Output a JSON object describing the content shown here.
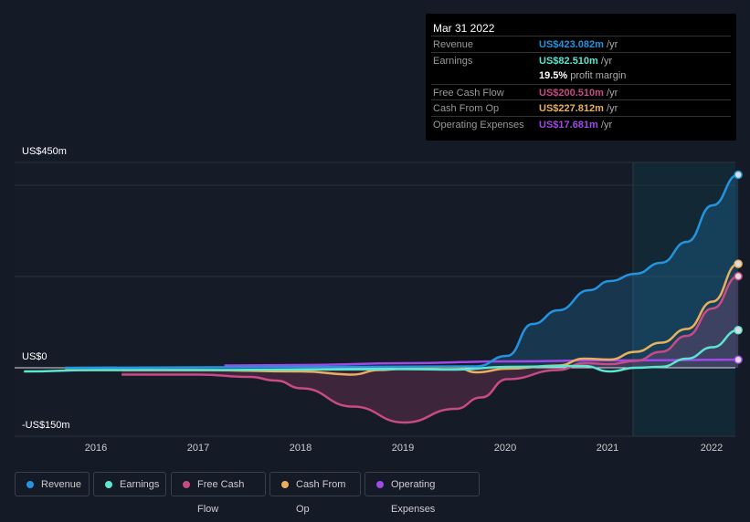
{
  "tooltip": {
    "date": "Mar 31 2022",
    "rows": [
      {
        "label": "Revenue",
        "value": "US$423.082m",
        "unit": " /yr",
        "color": "#2394df"
      },
      {
        "label": "Earnings",
        "value": "US$82.510m",
        "unit": " /yr",
        "color": "#5ce5cf"
      },
      {
        "label": "",
        "value": "19.5%",
        "unit": " profit margin",
        "color": "#ffffff"
      },
      {
        "label": "Free Cash Flow",
        "value": "US$200.510m",
        "unit": " /yr",
        "color": "#c84a86"
      },
      {
        "label": "Cash From Op",
        "value": "US$227.812m",
        "unit": " /yr",
        "color": "#e8b05d"
      },
      {
        "label": "Operating Expenses",
        "value": "US$17.681m",
        "unit": " /yr",
        "color": "#9f4ae8"
      }
    ]
  },
  "chart_data": {
    "type": "line",
    "ylim": [
      -150,
      450
    ],
    "y_tick_labels": [
      "US$450m",
      "US$0",
      "-US$150m"
    ],
    "x_tick_labels": [
      "2016",
      "2017",
      "2018",
      "2019",
      "2020",
      "2021",
      "2022"
    ],
    "series": [
      {
        "name": "Revenue",
        "color": "#2394df",
        "area": true,
        "points": [
          [
            2015.7,
            0
          ],
          [
            2019.7,
            3
          ],
          [
            2020,
            26
          ],
          [
            2020.25,
            96
          ],
          [
            2020.5,
            126
          ],
          [
            2020.8,
            170
          ],
          [
            2021,
            190
          ],
          [
            2021.25,
            206
          ],
          [
            2021.5,
            230
          ],
          [
            2021.75,
            276
          ],
          [
            2022,
            356
          ],
          [
            2022.25,
            423.082
          ]
        ]
      },
      {
        "name": "Earnings",
        "color": "#5ce5cf",
        "area": false,
        "points": [
          [
            2015.3,
            -8
          ],
          [
            2016,
            -5
          ],
          [
            2017,
            -5
          ],
          [
            2018,
            -4
          ],
          [
            2019,
            -3
          ],
          [
            2019.5,
            -4
          ],
          [
            2020,
            2
          ],
          [
            2020.75,
            4
          ],
          [
            2021,
            -8
          ],
          [
            2021.25,
            0
          ],
          [
            2021.5,
            2
          ],
          [
            2021.75,
            20
          ],
          [
            2022,
            45
          ],
          [
            2022.25,
            82.51
          ]
        ]
      },
      {
        "name": "Free Cash Flow",
        "color": "#c84a86",
        "area": true,
        "points": [
          [
            2016.25,
            -15
          ],
          [
            2017,
            -15
          ],
          [
            2017.5,
            -20
          ],
          [
            2017.75,
            -28
          ],
          [
            2018,
            -45
          ],
          [
            2018.5,
            -85
          ],
          [
            2019,
            -120
          ],
          [
            2019.5,
            -90
          ],
          [
            2019.75,
            -65
          ],
          [
            2020,
            -25
          ],
          [
            2020.5,
            -5
          ],
          [
            2020.75,
            10
          ],
          [
            2021,
            8
          ],
          [
            2021.25,
            15
          ],
          [
            2021.5,
            35
          ],
          [
            2021.75,
            70
          ],
          [
            2022,
            130
          ],
          [
            2022.25,
            200.51
          ]
        ]
      },
      {
        "name": "Cash From Op",
        "color": "#e8b05d",
        "area": false,
        "points": [
          [
            2015.7,
            -5
          ],
          [
            2017,
            -5
          ],
          [
            2018,
            -8
          ],
          [
            2018.5,
            -15
          ],
          [
            2018.75,
            -5
          ],
          [
            2019,
            -2
          ],
          [
            2019.5,
            2
          ],
          [
            2019.7,
            -10
          ],
          [
            2020,
            -2
          ],
          [
            2020.5,
            5
          ],
          [
            2020.75,
            20
          ],
          [
            2021,
            18
          ],
          [
            2021.25,
            35
          ],
          [
            2021.5,
            55
          ],
          [
            2021.75,
            85
          ],
          [
            2022,
            145
          ],
          [
            2022.25,
            227.812
          ]
        ]
      },
      {
        "name": "Operating Expenses",
        "color": "#9f4ae8",
        "area": false,
        "points": [
          [
            2017.25,
            5
          ],
          [
            2018,
            6
          ],
          [
            2019,
            10
          ],
          [
            2020,
            14
          ],
          [
            2021,
            16
          ],
          [
            2022.25,
            17.681
          ]
        ]
      }
    ]
  },
  "legend": [
    {
      "label": "Revenue",
      "color": "#2394df"
    },
    {
      "label": "Earnings",
      "color": "#5ce5cf"
    },
    {
      "label": "Free Cash Flow",
      "color": "#c84a86"
    },
    {
      "label": "Cash From Op",
      "color": "#e8b05d"
    },
    {
      "label": "Operating Expenses",
      "color": "#9f4ae8"
    }
  ]
}
